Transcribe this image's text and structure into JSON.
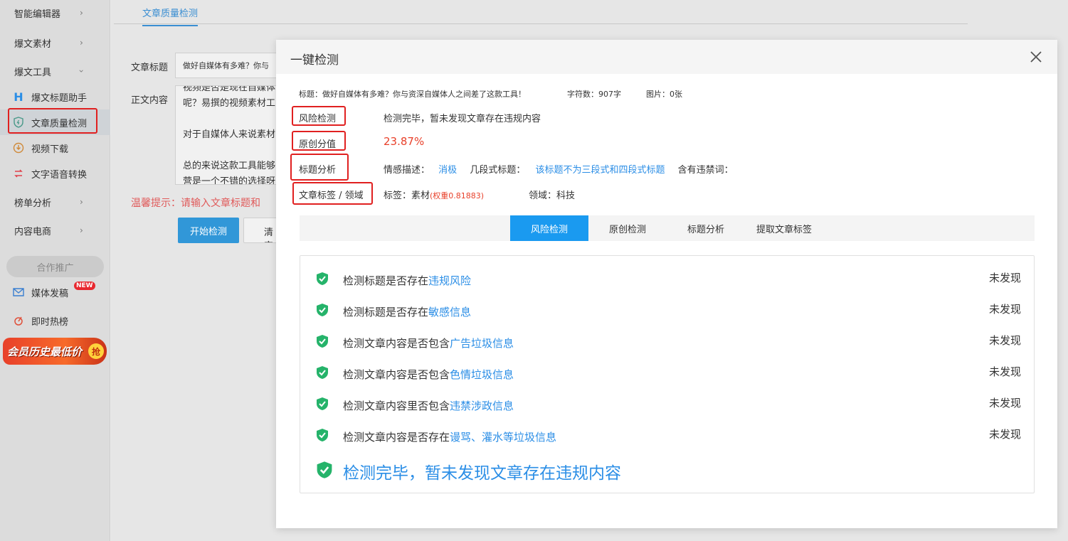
{
  "sidebar": {
    "menu": [
      {
        "label": "智能编辑器"
      },
      {
        "label": "爆文素材"
      },
      {
        "label": "爆文工具"
      }
    ],
    "tools": [
      {
        "label": "爆文标题助手",
        "icon": "h-icon"
      },
      {
        "label": "文章质量检测",
        "icon": "shield-icon"
      },
      {
        "label": "视频下载",
        "icon": "download-icon"
      },
      {
        "label": "文字语音转换",
        "icon": "convert-icon"
      }
    ],
    "menu2": [
      {
        "label": "榜单分析"
      },
      {
        "label": "内容电商"
      }
    ],
    "coop": "合作推广",
    "extra": [
      {
        "label": "媒体发稿",
        "icon": "mail-icon"
      },
      {
        "label": "即时热榜",
        "icon": "fire-icon"
      }
    ],
    "new_badge": "NEW",
    "promo": "会员历史最低价",
    "promo_tag": "抢"
  },
  "main": {
    "tab": "文章质量检测",
    "title_label": "文章标题",
    "title_value": "做好自媒体有多难？你与",
    "content_label": "正文内容",
    "content_lines": [
      "视频是否是现在自媒体",
      "呢？易撰的视频素材工",
      "",
      "对于自媒体人来说素材",
      "",
      "总的来说这款工具能够",
      "营是一个不错的选择呀"
    ],
    "warm_tip": "温馨提示：请输入文章标题和",
    "start_btn": "开始检测",
    "clear_btn": "清空"
  },
  "modal": {
    "title": "一键检测",
    "info_title": "标题：做好自媒体有多难？你与资深自媒体人之间差了这款工具！",
    "info_chars": "字符数：907字",
    "info_images": "图片：0张",
    "risk_label": "风险检测",
    "risk_value": "检测完毕，暂未发现文章存在违规内容",
    "orig_label": "原创分值",
    "orig_value": "23.87%",
    "title_analysis_label": "标题分析",
    "emotion_label": "情感描述：",
    "emotion_value": "消极",
    "segment_label": "几段式标题：",
    "segment_value": "该标题不为三段式和四段式标题",
    "forbidden_label": "含有违禁词：",
    "tags_label": "文章标签 / 领域",
    "tag_label": "标签：素材",
    "tag_weight": "(权重0.81883)",
    "domain_label": "领域：科技",
    "tabs": [
      "风险检测",
      "原创检测",
      "标题分析",
      "提取文章标签"
    ],
    "checks": [
      {
        "prefix": "检测标题是否存在",
        "highlight": "违规风险",
        "status": "未发现"
      },
      {
        "prefix": "检测标题是否存在",
        "highlight": "敏感信息",
        "status": "未发现"
      },
      {
        "prefix": "检测文章内容是否包含",
        "highlight": "广告垃圾信息",
        "status": "未发现"
      },
      {
        "prefix": "检测文章内容是否包含",
        "highlight": "色情垃圾信息",
        "status": "未发现"
      },
      {
        "prefix": "检测文章内容里否包含",
        "highlight": "违禁涉政信息",
        "status": "未发现"
      },
      {
        "prefix": "检测文章内容是否存在",
        "highlight": "谩骂、灌水等垃圾信息",
        "status": "未发现"
      }
    ],
    "final": "检测完毕，暂未发现文章存在违规内容"
  },
  "colors": {
    "accent": "#1a9af0",
    "link": "#2b8ee6",
    "danger": "#e8402a",
    "shield": "#25b36a"
  }
}
